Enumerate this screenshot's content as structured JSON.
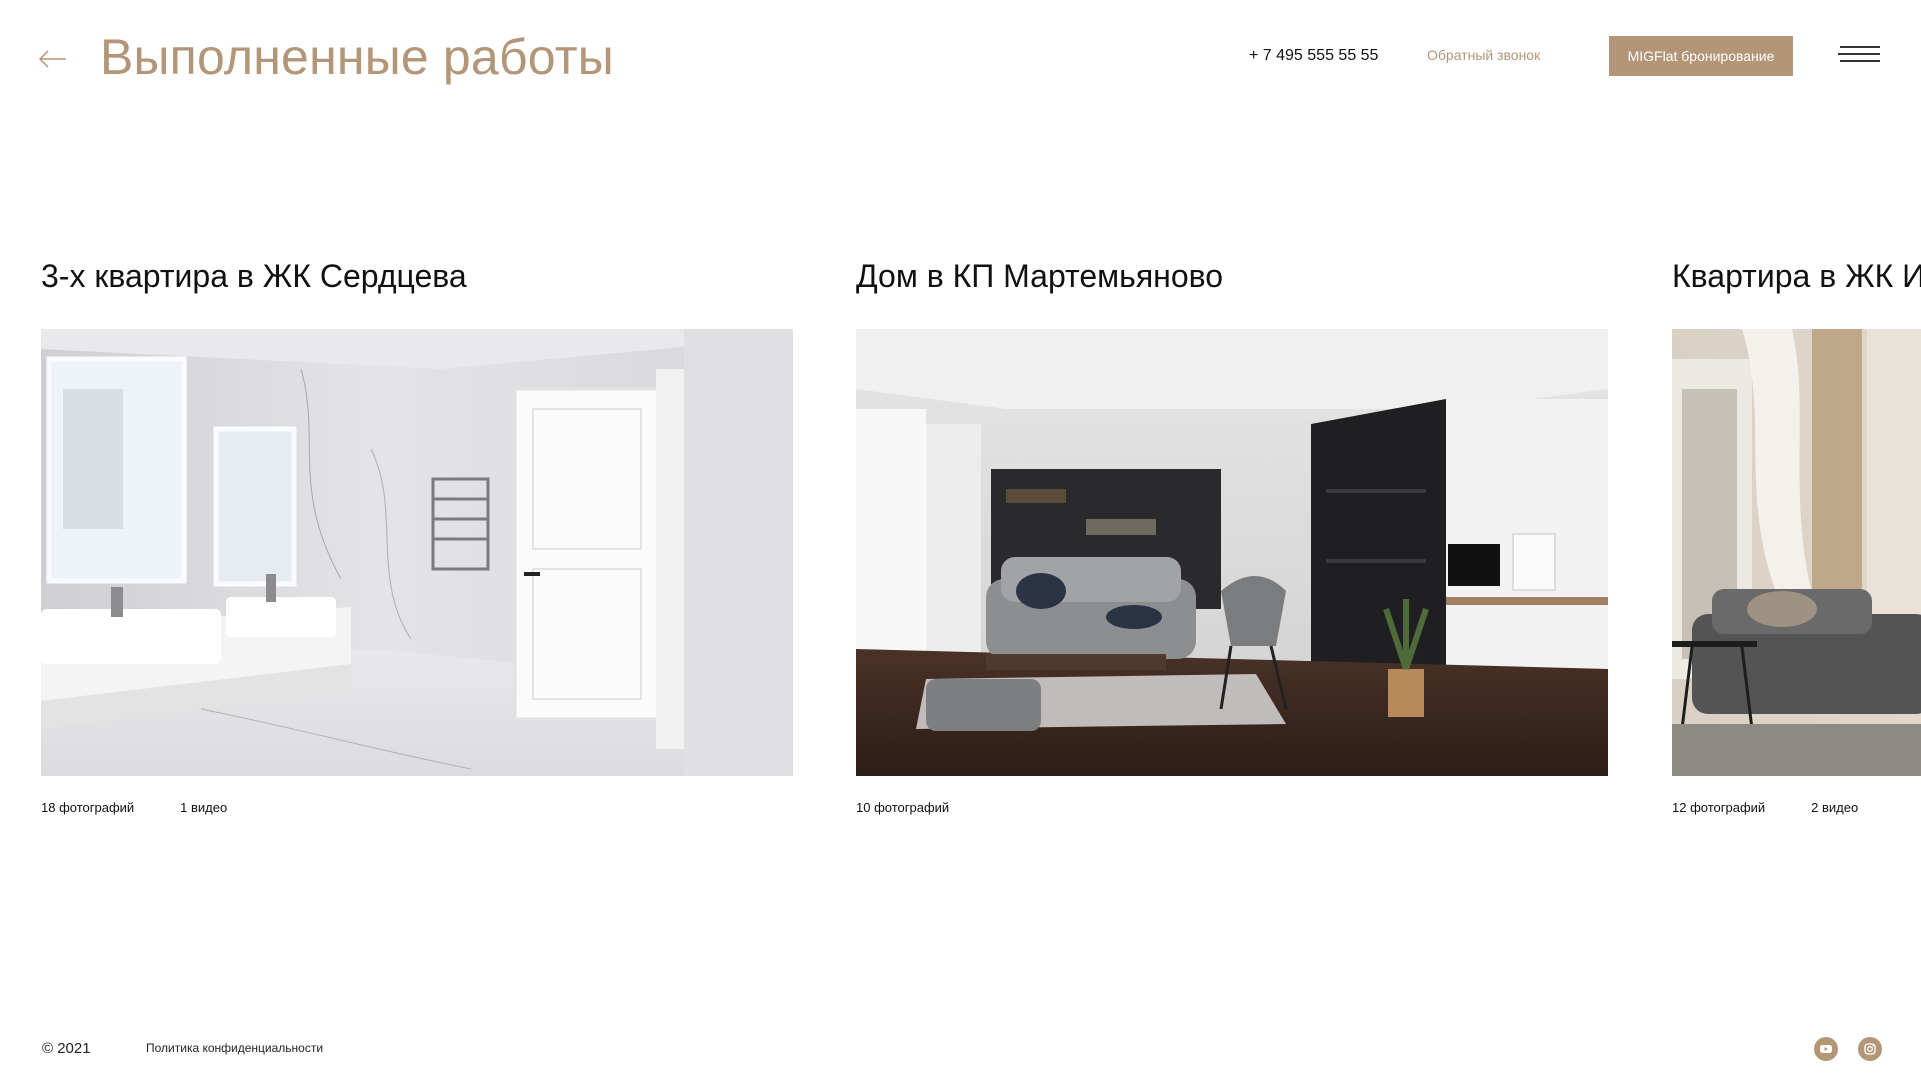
{
  "header": {
    "title": "Выполненные работы",
    "phone": "+ 7 495 555 55 55",
    "callback_label": "Обратный звонок",
    "booking_label": "MIGFlat бронирование"
  },
  "projects": [
    {
      "title": "3-х квартира в ЖК Сердцева",
      "photos": "18 фотографий",
      "videos": "1 видео"
    },
    {
      "title": "Дом в КП Мартемьяново",
      "photos": "10 фотографий"
    },
    {
      "title": "Квартира в ЖК И",
      "photos": "12 фотографий",
      "videos": "2 видео"
    }
  ],
  "footer": {
    "copyright": "© 2021",
    "privacy_label": "Политика конфиденциальности"
  },
  "icons": {
    "back": "arrow-left-icon",
    "menu": "hamburger-menu-icon",
    "youtube": "youtube-icon",
    "instagram": "instagram-icon"
  },
  "colors": {
    "accent": "#b39577",
    "text": "#111111",
    "background": "#ffffff"
  }
}
